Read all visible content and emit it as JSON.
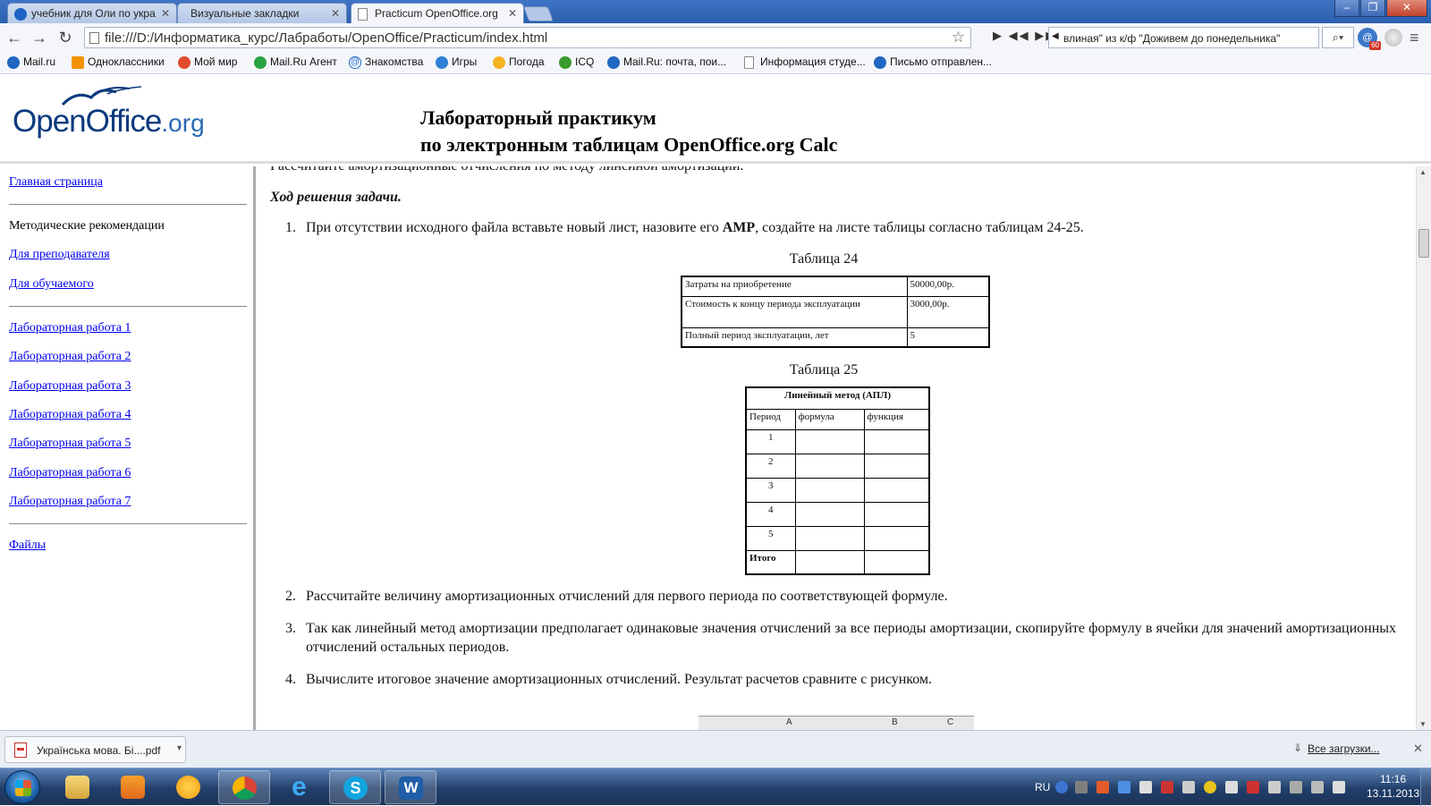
{
  "browser": {
    "tabs": [
      {
        "label": "учебник для Оли по укра",
        "active": false
      },
      {
        "label": "Визуальные закладки",
        "active": false
      },
      {
        "label": "Practicum OpenOffice.org",
        "active": true
      }
    ],
    "url": "file:///D:/Информатика_курс/Лабработы/OpenOffice/Practicum/index.html",
    "media_text": "влиная\" из к/ф \"Доживем до понедельника\"",
    "ext_badge": "60",
    "bookmarks": [
      {
        "label": "Mail.ru",
        "icon": "mailru-icon"
      },
      {
        "label": "Одноклассники",
        "icon": "odnoklassniki-icon"
      },
      {
        "label": "Мой мир",
        "icon": "moimir-icon"
      },
      {
        "label": "Mail.Ru Агент",
        "icon": "agent-icon"
      },
      {
        "label": "Знакомства",
        "icon": "at-icon"
      },
      {
        "label": "Игры",
        "icon": "games-icon"
      },
      {
        "label": "Погода",
        "icon": "weather-icon"
      },
      {
        "label": "ICQ",
        "icon": "icq-icon"
      },
      {
        "label": "Mail.Ru: почта, пои...",
        "icon": "mailru-icon"
      },
      {
        "label": "Информация студе...",
        "icon": "page-icon"
      },
      {
        "label": "Письмо отправлен...",
        "icon": "mailru-icon"
      }
    ]
  },
  "header": {
    "logo_main": "OpenOffice",
    "logo_org": ".org",
    "title_line1": "Лабораторный практикум",
    "title_line2": "по электронным таблицам OpenOffice.org Calc"
  },
  "sidebar": {
    "home": "Главная страница",
    "method_label": "Методические рекомендации",
    "teacher": "Для преподавателя",
    "student": "Для обучаемого",
    "labs": [
      "Лабораторная работа 1",
      "Лабораторная работа 2",
      "Лабораторная работа 3",
      "Лабораторная работа 4",
      "Лабораторная работа 5",
      "Лабораторная работа 6",
      "Лабораторная работа 7"
    ],
    "files": "Файлы"
  },
  "content": {
    "clipped_line": "Рассчитайте амортизационные отчисления по методу линейной амортизации.",
    "task_heading": "Ход решения задачи.",
    "steps": [
      {
        "num": "1.",
        "text_a": "При отсутствии исходного файла вставьте новый лист, назовите его ",
        "bold": "АМР",
        "text_b": ", создайте на листе таблицы согласно таблицам 24-25."
      },
      {
        "num": "2.",
        "text": "Рассчитайте величину амортизационных отчислений для первого периода по соответствующей формуле."
      },
      {
        "num": "3.",
        "text": "Так как линейный метод амортизации предполагает одинаковые значения отчислений за все периоды амортизации, скопируйте формулу в ячейки для значений амортизационных отчислений остальных периодов."
      },
      {
        "num": "4.",
        "text": "Вычислите итоговое значение амортизационных отчислений. Результат расчетов сравните с рисунком."
      }
    ],
    "table24": {
      "caption": "Таблица 24",
      "rows": [
        [
          "Затраты на приобретение",
          "50000,00р."
        ],
        [
          "Стоимость к концу периода эксплуатации",
          "3000,00р."
        ],
        [
          "Полный период эксплуатации, лет",
          "5"
        ]
      ]
    },
    "table25": {
      "caption": "Таблица 25",
      "header": "Линейный метод (АПЛ)",
      "columns": [
        "Период",
        "формула",
        "функция"
      ],
      "periods": [
        "1",
        "2",
        "3",
        "4",
        "5"
      ],
      "total": "Итого"
    },
    "sheet_cols": [
      "A",
      "B",
      "C"
    ]
  },
  "downloads": {
    "file": "Українська мова. Бі....pdf",
    "show_all": "Все загрузки..."
  },
  "taskbar": {
    "lang": "RU",
    "time": "11:16",
    "date": "13.11.2013"
  },
  "colors": {
    "link": "#0000ee",
    "logo": "#0b3a7e",
    "taskbar": "#223f6a"
  }
}
